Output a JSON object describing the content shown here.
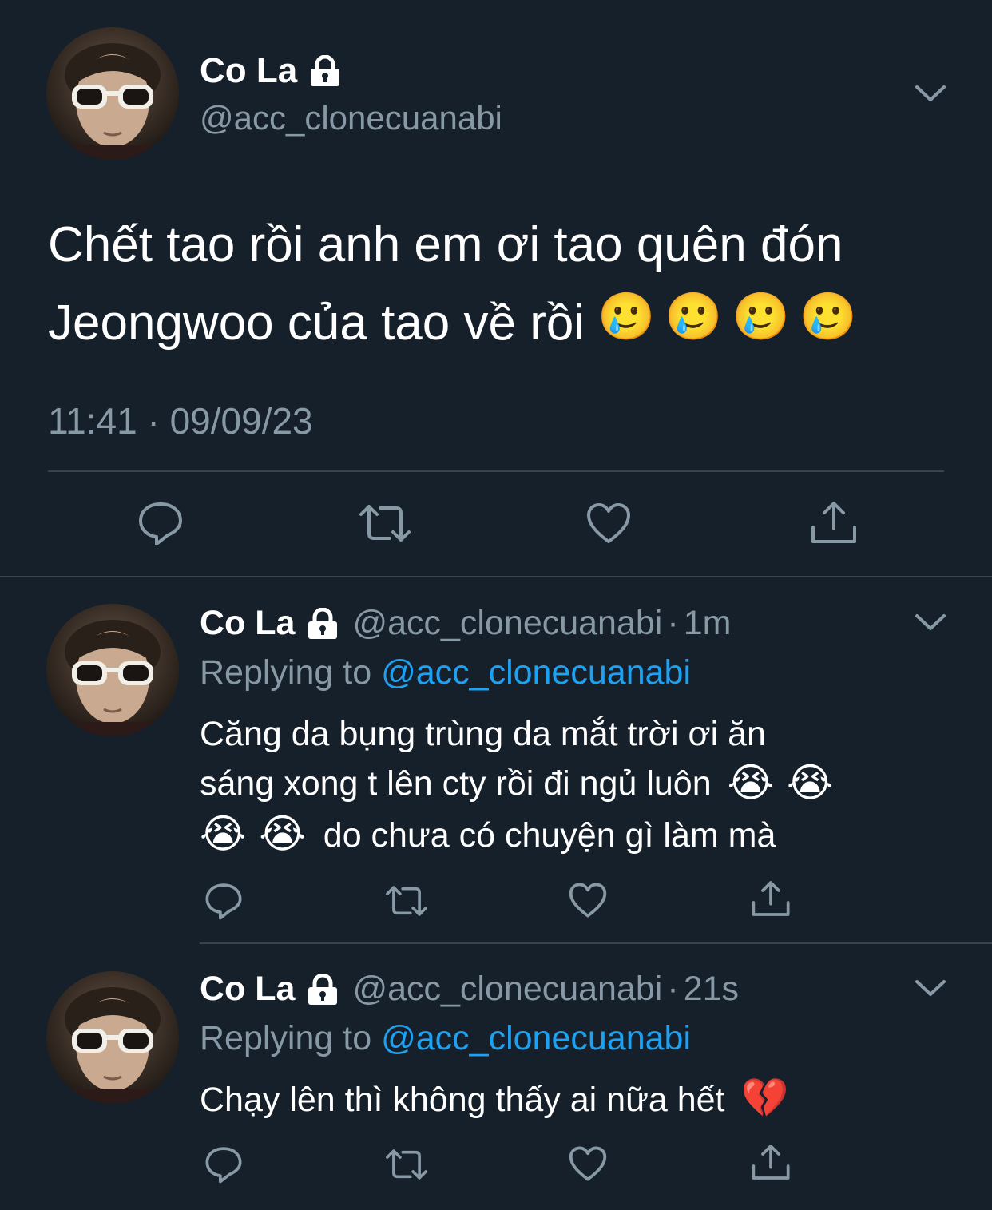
{
  "main_tweet": {
    "display_name": "Co La",
    "handle": "@acc_clonecuanabi",
    "text_line1": "Chết tao rồi anh em ơi tao quên đón",
    "text_line2": "Jeongwoo của tao về rồi",
    "text_emojis": [
      "🥲",
      "🥲",
      "🥲",
      "🥲"
    ],
    "timestamp": "11:41 · 09/09/23"
  },
  "replies": [
    {
      "display_name": "Co La",
      "handle": "@acc_clonecuanabi",
      "separator": "·",
      "time": "1m",
      "replying_prefix": "Replying to",
      "replying_mention": "@acc_clonecuanabi",
      "text_line1": "Căng da bụng trùng da mắt trời ơi ăn",
      "text_line2": "sáng xong t lên cty rồi đi ngủ luôn",
      "text_line3": "do chưa có chuyện gì làm mà",
      "line2_emojis": [
        "😭",
        "😭"
      ],
      "line3_emojis": [
        "😭",
        "😭"
      ]
    },
    {
      "display_name": "Co La",
      "handle": "@acc_clonecuanabi",
      "separator": "·",
      "time": "21s",
      "replying_prefix": "Replying to",
      "replying_mention": "@acc_clonecuanabi",
      "text_line1": "Chạy lên thì không thấy ai nữa hết",
      "line1_emojis": [
        "💔"
      ]
    }
  ],
  "icons": {
    "lock": "lock-icon",
    "menu": "chevron-down-icon",
    "reply": "reply-icon",
    "retweet": "retweet-icon",
    "like": "heart-icon",
    "share": "share-icon"
  },
  "colors": {
    "background": "#15202b",
    "text": "#ffffff",
    "secondary": "#8899a6",
    "accent": "#1da1f2",
    "divider": "#38444d"
  }
}
